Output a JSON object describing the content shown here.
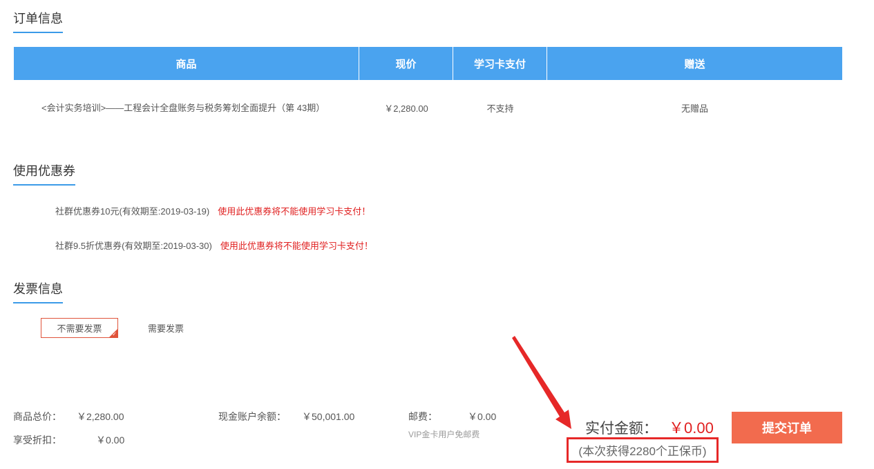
{
  "order_section": {
    "title": "订单信息",
    "headers": [
      "商品",
      "现价",
      "学习卡支付",
      "赠送"
    ],
    "row": {
      "product": "<会计实务培训>——工程会计全盘账务与税务筹划全面提升（第 43期）",
      "price": "￥2,280.00",
      "study_card": "不支持",
      "gift": "无赠品"
    }
  },
  "coupon_section": {
    "title": "使用优惠券",
    "coupons": [
      {
        "name": "社群优惠券10元(有效期至:2019-03-19)",
        "warning": "使用此优惠券将不能使用学习卡支付！"
      },
      {
        "name": "社群9.5折优惠券(有效期至:2019-03-30)",
        "warning": "使用此优惠券将不能使用学习卡支付！"
      }
    ]
  },
  "invoice_section": {
    "title": "发票信息",
    "options": [
      "不需要发票",
      "需要发票"
    ],
    "selected": "不需要发票"
  },
  "summary": {
    "total_label": "商品总价：",
    "total_value": "￥2,280.00",
    "discount_label": "享受折扣：",
    "discount_value": "￥0.00",
    "balance_label": "现金账户余额：",
    "balance_value": "￥50,001.00",
    "shipping_label": "邮费：",
    "shipping_value": "￥0.00",
    "shipping_note": "VIP金卡用户免邮费",
    "pay_label": "实付金额：",
    "pay_value": "￥0.00",
    "coin_note": "(本次获得2280个正保币)",
    "submit_label": "提交订单"
  },
  "colors": {
    "table_header": "#4aa3ef",
    "accent_red": "#e02020",
    "submit_button": "#f26b4e",
    "annotation": "#e62828"
  }
}
